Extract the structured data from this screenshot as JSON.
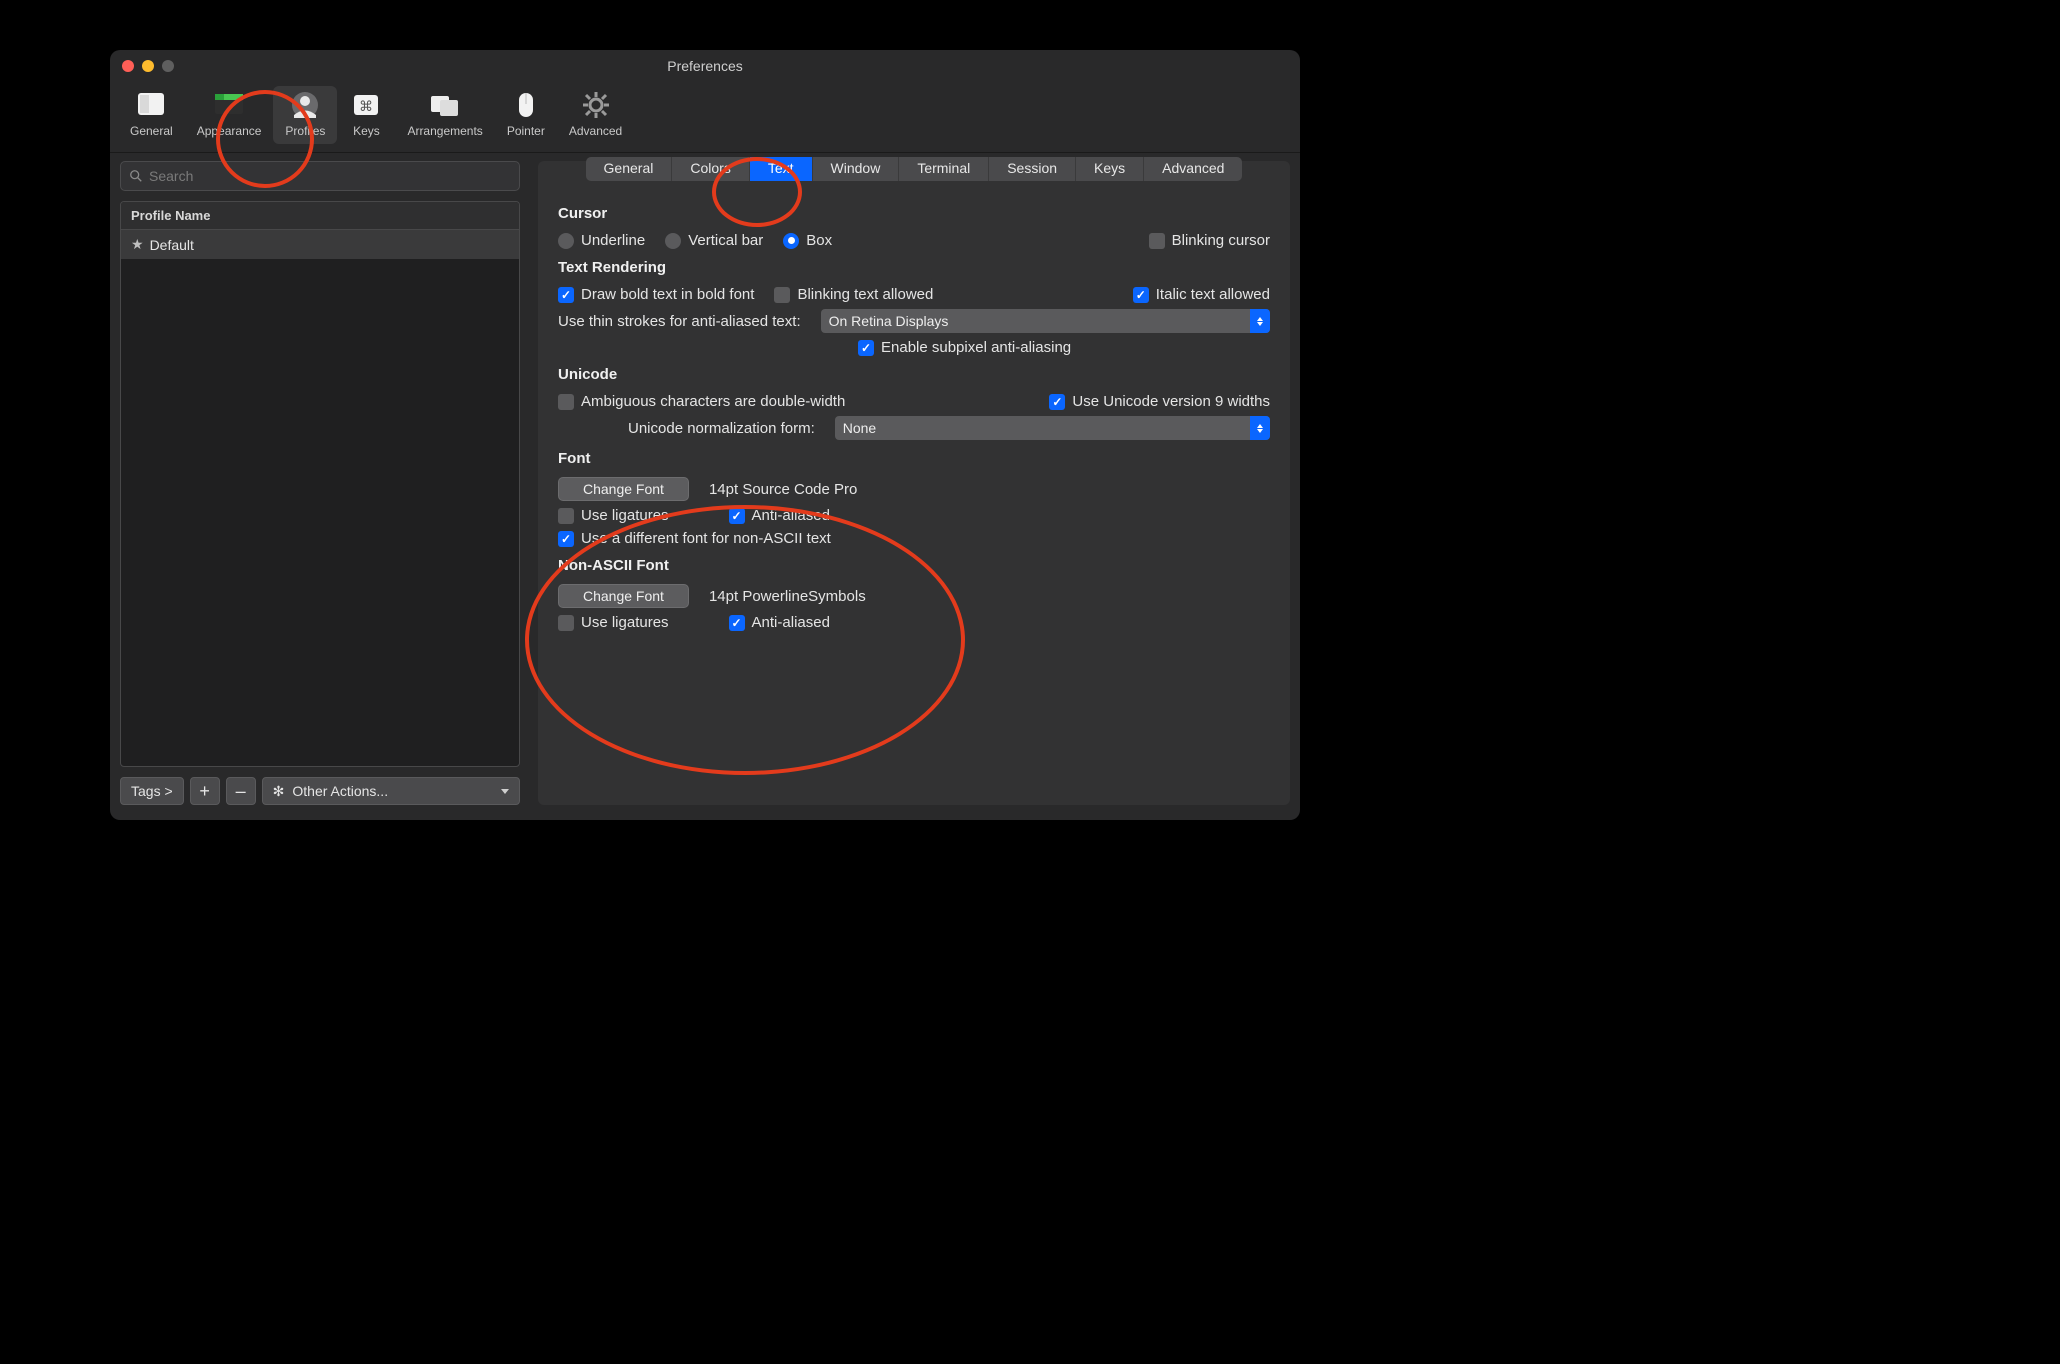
{
  "window": {
    "title": "Preferences"
  },
  "toolbar": {
    "items": [
      {
        "label": "General"
      },
      {
        "label": "Appearance"
      },
      {
        "label": "Profiles"
      },
      {
        "label": "Keys"
      },
      {
        "label": "Arrangements"
      },
      {
        "label": "Pointer"
      },
      {
        "label": "Advanced"
      }
    ],
    "active_index": 2
  },
  "sidebar": {
    "search_placeholder": "Search",
    "header": "Profile Name",
    "profiles": [
      {
        "name": "Default",
        "is_default": true
      }
    ],
    "footer": {
      "tags_label": "Tags >",
      "plus": "+",
      "minus": "–",
      "other_actions": "Other Actions..."
    }
  },
  "tabs": {
    "items": [
      "General",
      "Colors",
      "Text",
      "Window",
      "Terminal",
      "Session",
      "Keys",
      "Advanced"
    ],
    "active_index": 2
  },
  "sections": {
    "cursor": {
      "title": "Cursor",
      "shapes": {
        "underline": "Underline",
        "vertical_bar": "Vertical bar",
        "box": "Box",
        "selected": "box"
      },
      "blinking_cursor": {
        "label": "Blinking cursor",
        "checked": false
      }
    },
    "text_rendering": {
      "title": "Text Rendering",
      "bold": {
        "label": "Draw bold text in bold font",
        "checked": true
      },
      "blink_text": {
        "label": "Blinking text allowed",
        "checked": false
      },
      "italic": {
        "label": "Italic text allowed",
        "checked": true
      },
      "thin_strokes_label": "Use thin strokes for anti-aliased text:",
      "thin_strokes_value": "On Retina Displays",
      "subpixel": {
        "label": "Enable subpixel anti-aliasing",
        "checked": true
      }
    },
    "unicode": {
      "title": "Unicode",
      "ambiguous": {
        "label": "Ambiguous characters are double-width",
        "checked": false
      },
      "v9": {
        "label": "Use Unicode version 9 widths",
        "checked": true
      },
      "norm_label": "Unicode normalization form:",
      "norm_value": "None"
    },
    "font": {
      "title": "Font",
      "change_btn": "Change Font",
      "desc": "14pt Source Code Pro",
      "ligatures": {
        "label": "Use ligatures",
        "checked": false
      },
      "aa": {
        "label": "Anti-aliased",
        "checked": true
      },
      "diff_nonascii": {
        "label": "Use a different font for non-ASCII text",
        "checked": true
      }
    },
    "nonascii_font": {
      "title": "Non-ASCII Font",
      "change_btn": "Change Font",
      "desc": "14pt PowerlineSymbols",
      "ligatures": {
        "label": "Use ligatures",
        "checked": false
      },
      "aa": {
        "label": "Anti-aliased",
        "checked": true
      }
    }
  }
}
